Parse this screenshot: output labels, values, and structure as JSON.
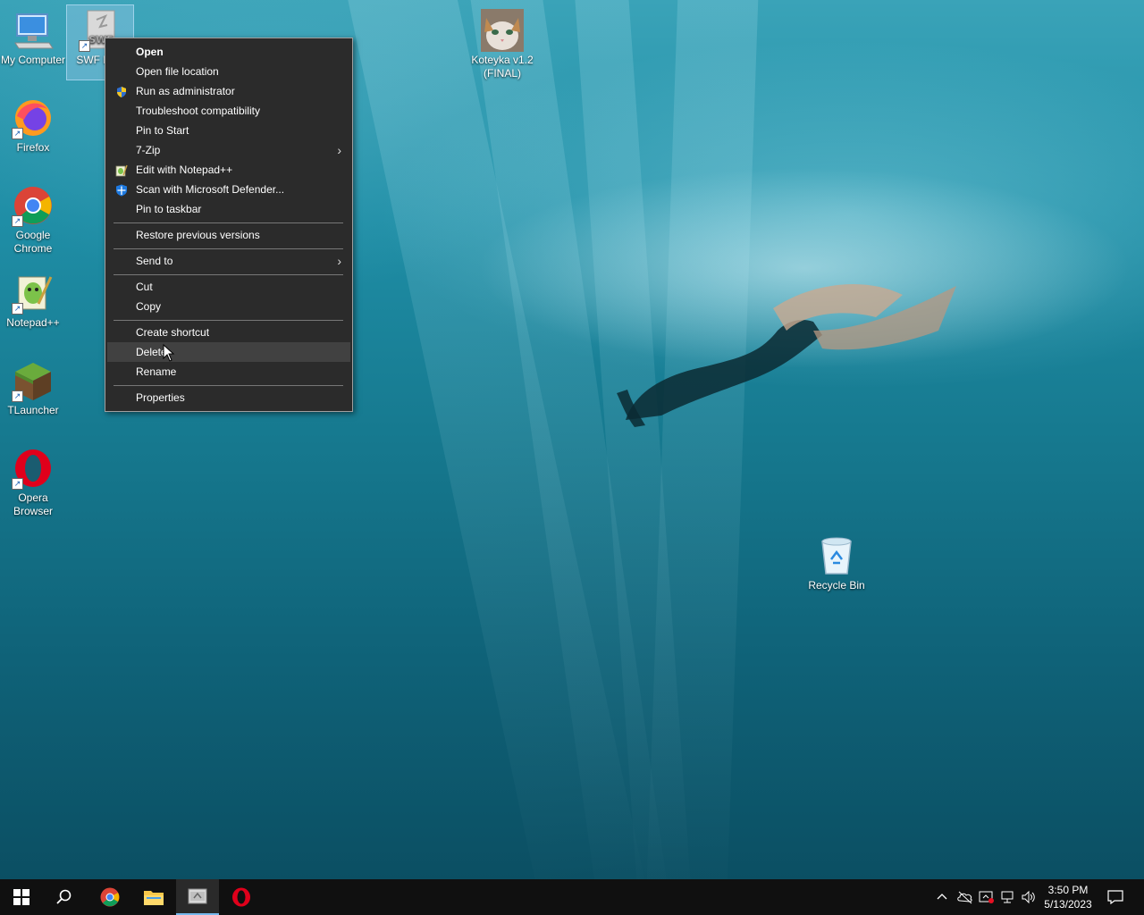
{
  "desktop": {
    "icons": [
      {
        "label": "My Computer"
      },
      {
        "label": "SWF Play"
      },
      {
        "label": "Firefox"
      },
      {
        "label": "Google Chrome"
      },
      {
        "label": "Notepad++"
      },
      {
        "label": "TLauncher"
      },
      {
        "label": "Opera Browser"
      },
      {
        "label": "Koteyka v1.2 (FINAL)"
      },
      {
        "label": "Recycle Bin"
      }
    ]
  },
  "context_menu": {
    "items": [
      {
        "label": "Open"
      },
      {
        "label": "Open file location"
      },
      {
        "label": "Run as administrator"
      },
      {
        "label": "Troubleshoot compatibility"
      },
      {
        "label": "Pin to Start"
      },
      {
        "label": "7-Zip"
      },
      {
        "label": "Edit with Notepad++"
      },
      {
        "label": "Scan with Microsoft Defender..."
      },
      {
        "label": "Pin to taskbar"
      },
      {
        "label": "Restore previous versions"
      },
      {
        "label": "Send to"
      },
      {
        "label": "Cut"
      },
      {
        "label": "Copy"
      },
      {
        "label": "Create shortcut"
      },
      {
        "label": "Delete"
      },
      {
        "label": "Rename"
      },
      {
        "label": "Properties"
      }
    ],
    "submenu_glyph": "›"
  },
  "taskbar": {
    "clock_time": "3:50 PM",
    "clock_date": "5/13/2023"
  },
  "colors": {
    "menu_bg": "#2b2b2b",
    "menu_hover": "#414141",
    "taskbar_bg": "#101010",
    "accent": "#76b9ed"
  }
}
